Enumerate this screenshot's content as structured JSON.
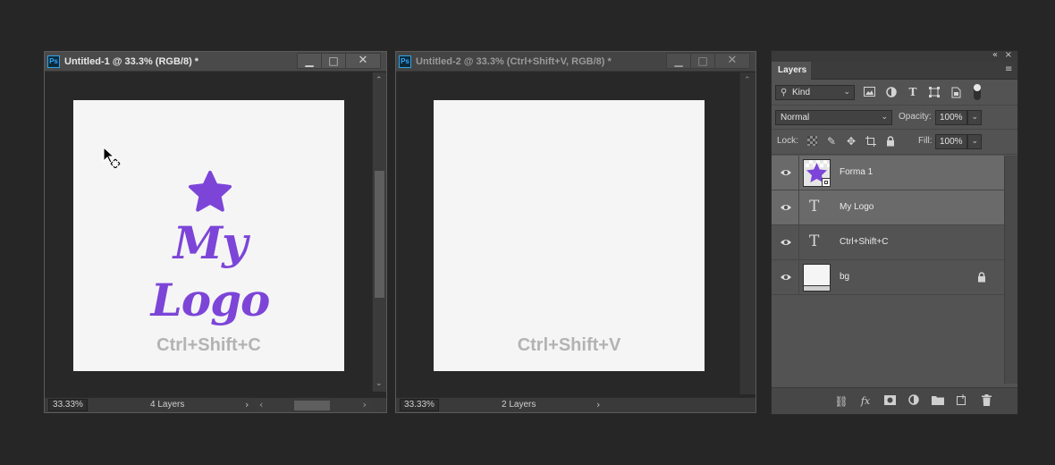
{
  "window1": {
    "ps_badge": "Ps",
    "title": "Untitled-1 @ 33.3% (RGB/8) *",
    "zoom": "33.33%",
    "layer_count": "4 Layers",
    "canvas_logo_text": "My Logo",
    "canvas_shortcut_text": "Ctrl+Shift+C"
  },
  "window2": {
    "ps_badge": "Ps",
    "title": "Untitled-2 @ 33.3% (Ctrl+Shift+V, RGB/8) *",
    "zoom": "33.33%",
    "layer_count": "2 Layers",
    "canvas_shortcut_text": "Ctrl+Shift+V"
  },
  "window_buttons": {
    "minimize": "▁",
    "maximize": "□",
    "close": "✕"
  },
  "layers_panel": {
    "tab_label": "Layers",
    "filter_kind": "Kind",
    "blend_mode": "Normal",
    "opacity_label": "Opacity:",
    "opacity_value": "100%",
    "lock_label": "Lock:",
    "fill_label": "Fill:",
    "fill_value": "100%",
    "layers": [
      {
        "name": "Forma 1",
        "type": "shape",
        "selected": true
      },
      {
        "name": "My Logo",
        "type": "text",
        "selected": true
      },
      {
        "name": "Ctrl+Shift+C",
        "type": "text",
        "selected": false
      },
      {
        "name": "bg",
        "type": "pixel",
        "selected": false,
        "locked": true
      }
    ],
    "footer_fx": "fx"
  },
  "colors": {
    "accent_purple": "#7c45d8",
    "canvas_bg": "#f5f5f5",
    "shortcut_text_gray": "#b3b3b3",
    "app_bg": "#262626",
    "panel_bg": "#535353"
  },
  "icons": {
    "move_cursor": "move-cursor-icon",
    "eye": "eye-icon",
    "lock": "lock-icon",
    "text_layer": "T"
  }
}
